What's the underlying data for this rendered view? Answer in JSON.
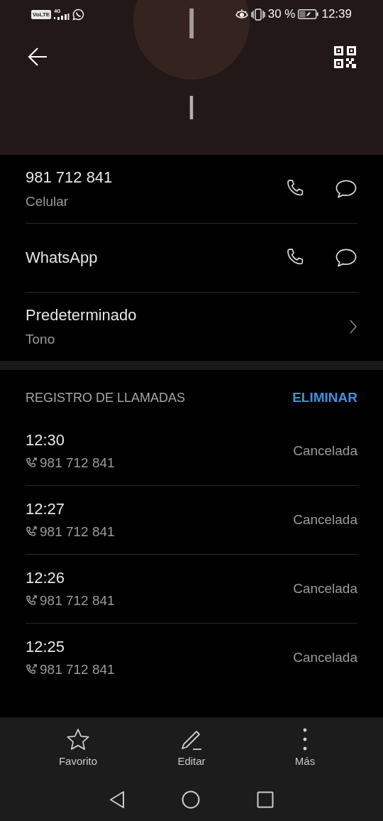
{
  "status_bar": {
    "network_badge": "VoLTE",
    "network_type": "4G",
    "battery": "30 %",
    "time": "12:39"
  },
  "header": {
    "avatar_initial": "I",
    "name": "I"
  },
  "contact_rows": [
    {
      "kind": "number",
      "title": "981 712 841",
      "subtitle": "Celular"
    },
    {
      "kind": "app",
      "title": "WhatsApp"
    },
    {
      "kind": "ringtone",
      "title": "Predeterminado",
      "subtitle": "Tono"
    }
  ],
  "call_log": {
    "title": "REGISTRO DE LLAMADAS",
    "action": "ELIMINAR",
    "calls": [
      {
        "time": "12:30",
        "number": "981 712 841",
        "status": "Cancelada"
      },
      {
        "time": "12:27",
        "number": "981 712 841",
        "status": "Cancelada"
      },
      {
        "time": "12:26",
        "number": "981 712 841",
        "status": "Cancelada"
      },
      {
        "time": "12:25",
        "number": "981 712 841",
        "status": "Cancelada"
      }
    ]
  },
  "actions": [
    {
      "kind": "favorite",
      "label": "Favorito"
    },
    {
      "kind": "edit",
      "label": "Editar"
    },
    {
      "kind": "more",
      "label": "Más"
    }
  ]
}
